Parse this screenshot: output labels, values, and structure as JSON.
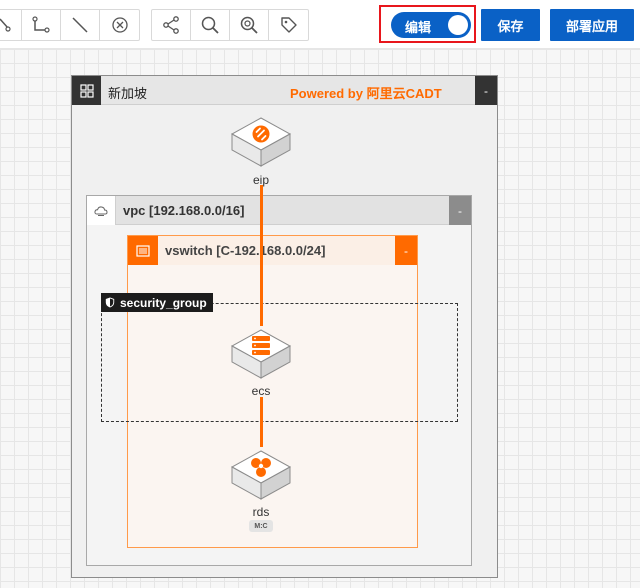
{
  "toolbar": {
    "tools_group1": [
      {
        "icon": "connector-icon"
      },
      {
        "icon": "elbow-connector-icon"
      },
      {
        "icon": "line-icon"
      },
      {
        "icon": "delete-icon"
      }
    ],
    "tools_group2": [
      {
        "icon": "share-icon"
      },
      {
        "icon": "zoom-icon"
      },
      {
        "icon": "find-node-icon"
      },
      {
        "icon": "tag-icon"
      }
    ],
    "edit_toggle": {
      "label": "编辑",
      "on": true
    },
    "save_label": "保存",
    "deploy_label": "部署应用"
  },
  "diagram": {
    "region": {
      "title": "新加坡",
      "powered_by": "Powered by 阿里云CADT",
      "collapse": "-"
    },
    "vpc": {
      "title": "vpc [192.168.0.0/16]",
      "collapse": "-"
    },
    "vswitch": {
      "title": "vswitch [C-192.168.0.0/24]",
      "collapse": "-"
    },
    "security_group": {
      "title": "security_group"
    },
    "nodes": {
      "eip": {
        "label": "eip"
      },
      "ecs": {
        "label": "ecs"
      },
      "rds": {
        "label": "rds",
        "badge": "M:C"
      }
    }
  },
  "colors": {
    "accent": "#ff6a00",
    "primary": "#0a61c6",
    "highlight": "#e8161c"
  }
}
